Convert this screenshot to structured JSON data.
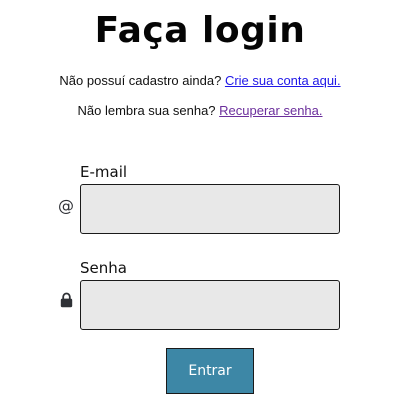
{
  "page": {
    "title": "Faça login"
  },
  "signup": {
    "prompt": "Não possuí cadastro ainda?",
    "link_label": "Crie sua conta aqui."
  },
  "recover": {
    "prompt": "Não lembra sua senha?",
    "link_label": "Recuperar senha."
  },
  "form": {
    "email": {
      "label": "E-mail",
      "icon": "at-sign-icon",
      "value": "",
      "placeholder": ""
    },
    "password": {
      "label": "Senha",
      "icon": "lock-icon",
      "value": "",
      "placeholder": ""
    },
    "submit_label": "Entrar"
  },
  "colors": {
    "link": "#1f17e8",
    "visited_link": "#6b2e9c",
    "input_background": "#e8e8e8",
    "button_background": "#3d87a6",
    "button_text": "#ffffff"
  }
}
